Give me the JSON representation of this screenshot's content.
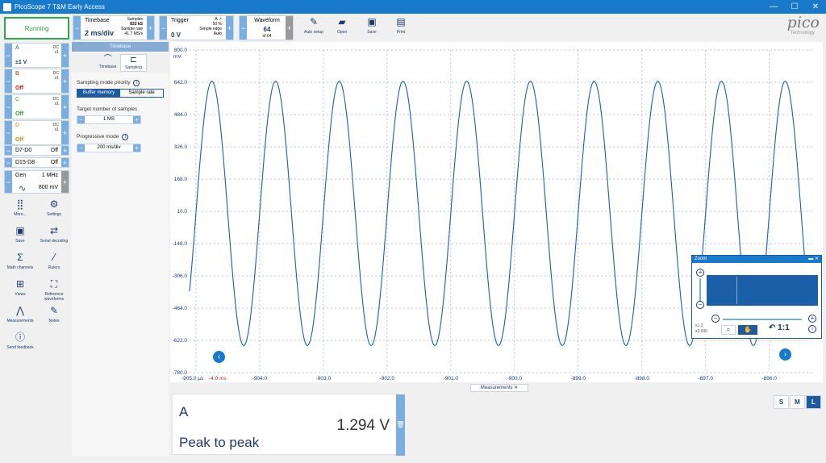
{
  "window": {
    "title": "PicoScope 7 T&M Early Access"
  },
  "run_button": "Running",
  "channels": [
    {
      "name": "A",
      "coupling": "DC",
      "probe": "x1",
      "value": "±1 V",
      "color": "#1960a8"
    },
    {
      "name": "B",
      "coupling": "DC",
      "probe": "x1",
      "value": "Off",
      "color": "#d02020"
    },
    {
      "name": "C",
      "coupling": "DC",
      "probe": "x1",
      "value": "Off",
      "color": "#2e9a3a"
    },
    {
      "name": "D",
      "coupling": "DC",
      "probe": "x1",
      "value": "Off",
      "color": "#d08a10"
    }
  ],
  "digital": [
    {
      "name": "D7-D0",
      "value": "Off"
    },
    {
      "name": "D15-D8",
      "value": "Off"
    }
  ],
  "generator": {
    "label": "Gen",
    "frequency": "1 MHz",
    "amplitude": "800 mV"
  },
  "tools": [
    {
      "label": "More...",
      "icon": "grid-icon"
    },
    {
      "label": "Settings",
      "icon": "gear-icon"
    },
    {
      "label": "Save",
      "icon": "save-icon"
    },
    {
      "label": "Serial decoding",
      "icon": "serial-decoding-icon"
    },
    {
      "label": "Math channels",
      "icon": "sigma-icon"
    },
    {
      "label": "Rulers",
      "icon": "ruler-icon"
    },
    {
      "label": "Views",
      "icon": "views-icon"
    },
    {
      "label": "Reference waveforms",
      "icon": "reference-waveforms-icon"
    },
    {
      "label": "Measurements",
      "icon": "measurements-icon"
    },
    {
      "label": "Notes",
      "icon": "notes-icon"
    },
    {
      "label": "Send feedback",
      "icon": "feedback-icon"
    }
  ],
  "timebase": {
    "label": "Timebase",
    "value": "2 ms/div",
    "samples_label": "Samples",
    "samples_value": "833 kS",
    "rate_label": "Sample rate",
    "rate_value": "41.7 MS/s"
  },
  "trigger": {
    "label": "Trigger",
    "channel": "A",
    "level_pct": "50 %",
    "mode": "Simple edge",
    "auto": "Auto",
    "value": "0 V"
  },
  "waveform": {
    "label": "Waveform",
    "value": "64",
    "of": "of 64"
  },
  "actions": [
    {
      "label": "Auto setup",
      "icon": "auto-setup-icon"
    },
    {
      "label": "Open",
      "icon": "folder-icon"
    },
    {
      "label": "Save",
      "icon": "save-icon"
    },
    {
      "label": "Print",
      "icon": "print-icon"
    }
  ],
  "logo": {
    "text": "pico",
    "sub": "Technology"
  },
  "panel": {
    "header": "Timebase",
    "tabs": [
      "Timebase",
      "Sampling"
    ],
    "mode_label": "Sampling mode priority",
    "modes": [
      "Buffer memory",
      "Sample rate"
    ],
    "samples_label": "Target number of samples",
    "samples_value": "1 MS",
    "progressive_label": "Progressive mode",
    "progressive_value": "200 ms/div"
  },
  "chart_data": {
    "type": "line",
    "title": "",
    "y_unit": "mV",
    "x_unit": "µs",
    "yticks": [
      "800.0",
      "642.0",
      "484.0",
      "326.0",
      "168.0",
      "10.0",
      "-148.0",
      "-306.0",
      "-464.0",
      "-622.0",
      "-780.0"
    ],
    "ylim": [
      -780,
      800
    ],
    "xticks": [
      "-905.0",
      "-904.0",
      "-903.0",
      "-902.0",
      "-901.0",
      "-900.0",
      "-899.0",
      "-898.0",
      "-897.0",
      "-896.0"
    ],
    "xlim": [
      -905.1,
      -895.3
    ],
    "x_origin_label": "-905.0 µs",
    "trigger_offset": "-4.0 ms",
    "series": [
      {
        "name": "A",
        "amplitude_mv": 647,
        "frequency_mhz": 1.0,
        "phase_x_at_peak_us": -904.75,
        "color": "#1960a8"
      }
    ]
  },
  "measurements": {
    "tab": "Measurements",
    "card": {
      "channel": "A",
      "name": "Peak to peak",
      "value": "1.294 V"
    },
    "sizes": [
      "S",
      "M",
      "L"
    ],
    "active_size": "L"
  },
  "zoom": {
    "title": "Zoom",
    "x_scale": "x1.3",
    "y_scale": "x2,000",
    "ratio": "1:1"
  }
}
